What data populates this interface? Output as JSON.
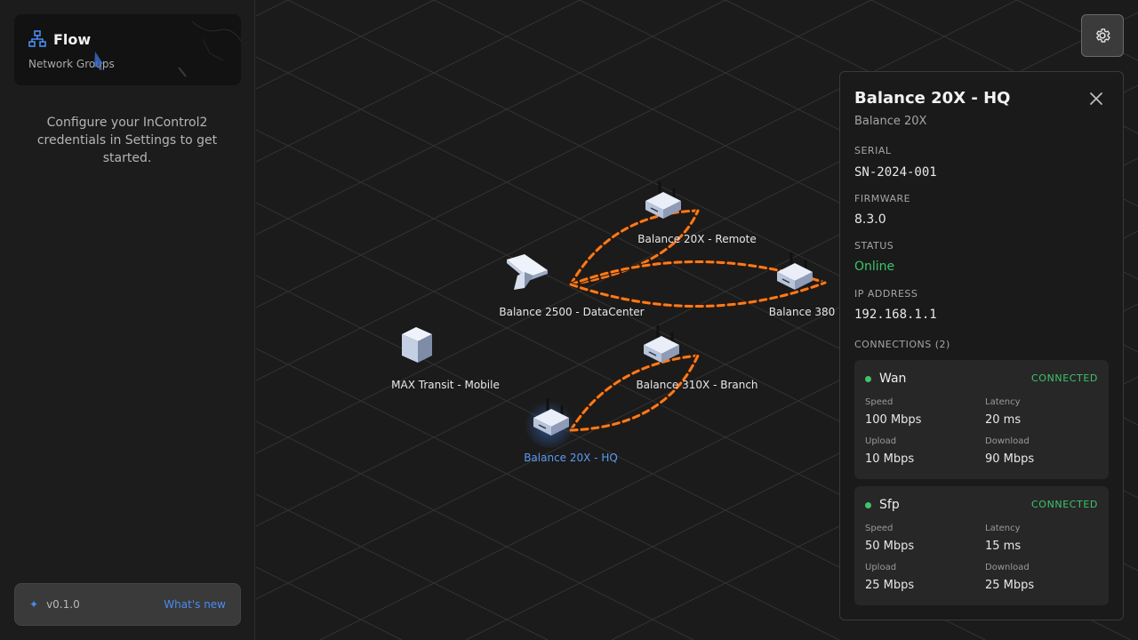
{
  "sidebar": {
    "brand_title": "Flow",
    "brand_subtitle": "Network Groups",
    "config_message": "Configure your InControl2 credentials in Settings to get started.",
    "version": "v0.1.0",
    "whats_new": "What's new"
  },
  "canvas": {
    "nodes": [
      {
        "label": "Balance 20X - Remote",
        "icon": "router-icon"
      },
      {
        "label": "Balance 2500 - DataCenter",
        "icon": "datacenter-appliance-icon"
      },
      {
        "label": "Balance 380",
        "icon": "router-icon"
      },
      {
        "label": "MAX Transit - Mobile",
        "icon": "cube-device-icon"
      },
      {
        "label": "Balance 310X - Branch",
        "icon": "router-icon"
      },
      {
        "label": "Balance 20X - HQ",
        "icon": "router-icon",
        "selected": true
      }
    ],
    "link_color": "#ff7a1a"
  },
  "settings": {
    "icon": "gear-icon"
  },
  "panel": {
    "title": "Balance 20X - HQ",
    "model": "Balance 20X",
    "serial_label": "SERIAL",
    "serial": "SN-2024-001",
    "firmware_label": "FIRMWARE",
    "firmware": "8.3.0",
    "status_label": "STATUS",
    "status": "Online",
    "ip_label": "IP ADDRESS",
    "ip": "192.168.1.1",
    "connections_label": "CONNECTIONS (2)",
    "connections": [
      {
        "name": "Wan",
        "state": "CONNECTED",
        "speed_label": "Speed",
        "speed": "100 Mbps",
        "latency_label": "Latency",
        "latency": "20 ms",
        "upload_label": "Upload",
        "upload": "10 Mbps",
        "download_label": "Download",
        "download": "90 Mbps"
      },
      {
        "name": "Sfp",
        "state": "CONNECTED",
        "speed_label": "Speed",
        "speed": "50 Mbps",
        "latency_label": "Latency",
        "latency": "15 ms",
        "upload_label": "Upload",
        "upload": "25 Mbps",
        "download_label": "Download",
        "download": "25 Mbps"
      }
    ]
  },
  "colors": {
    "accent": "#4a8cf0",
    "online": "#3ec46d",
    "link": "#ff7a1a"
  }
}
